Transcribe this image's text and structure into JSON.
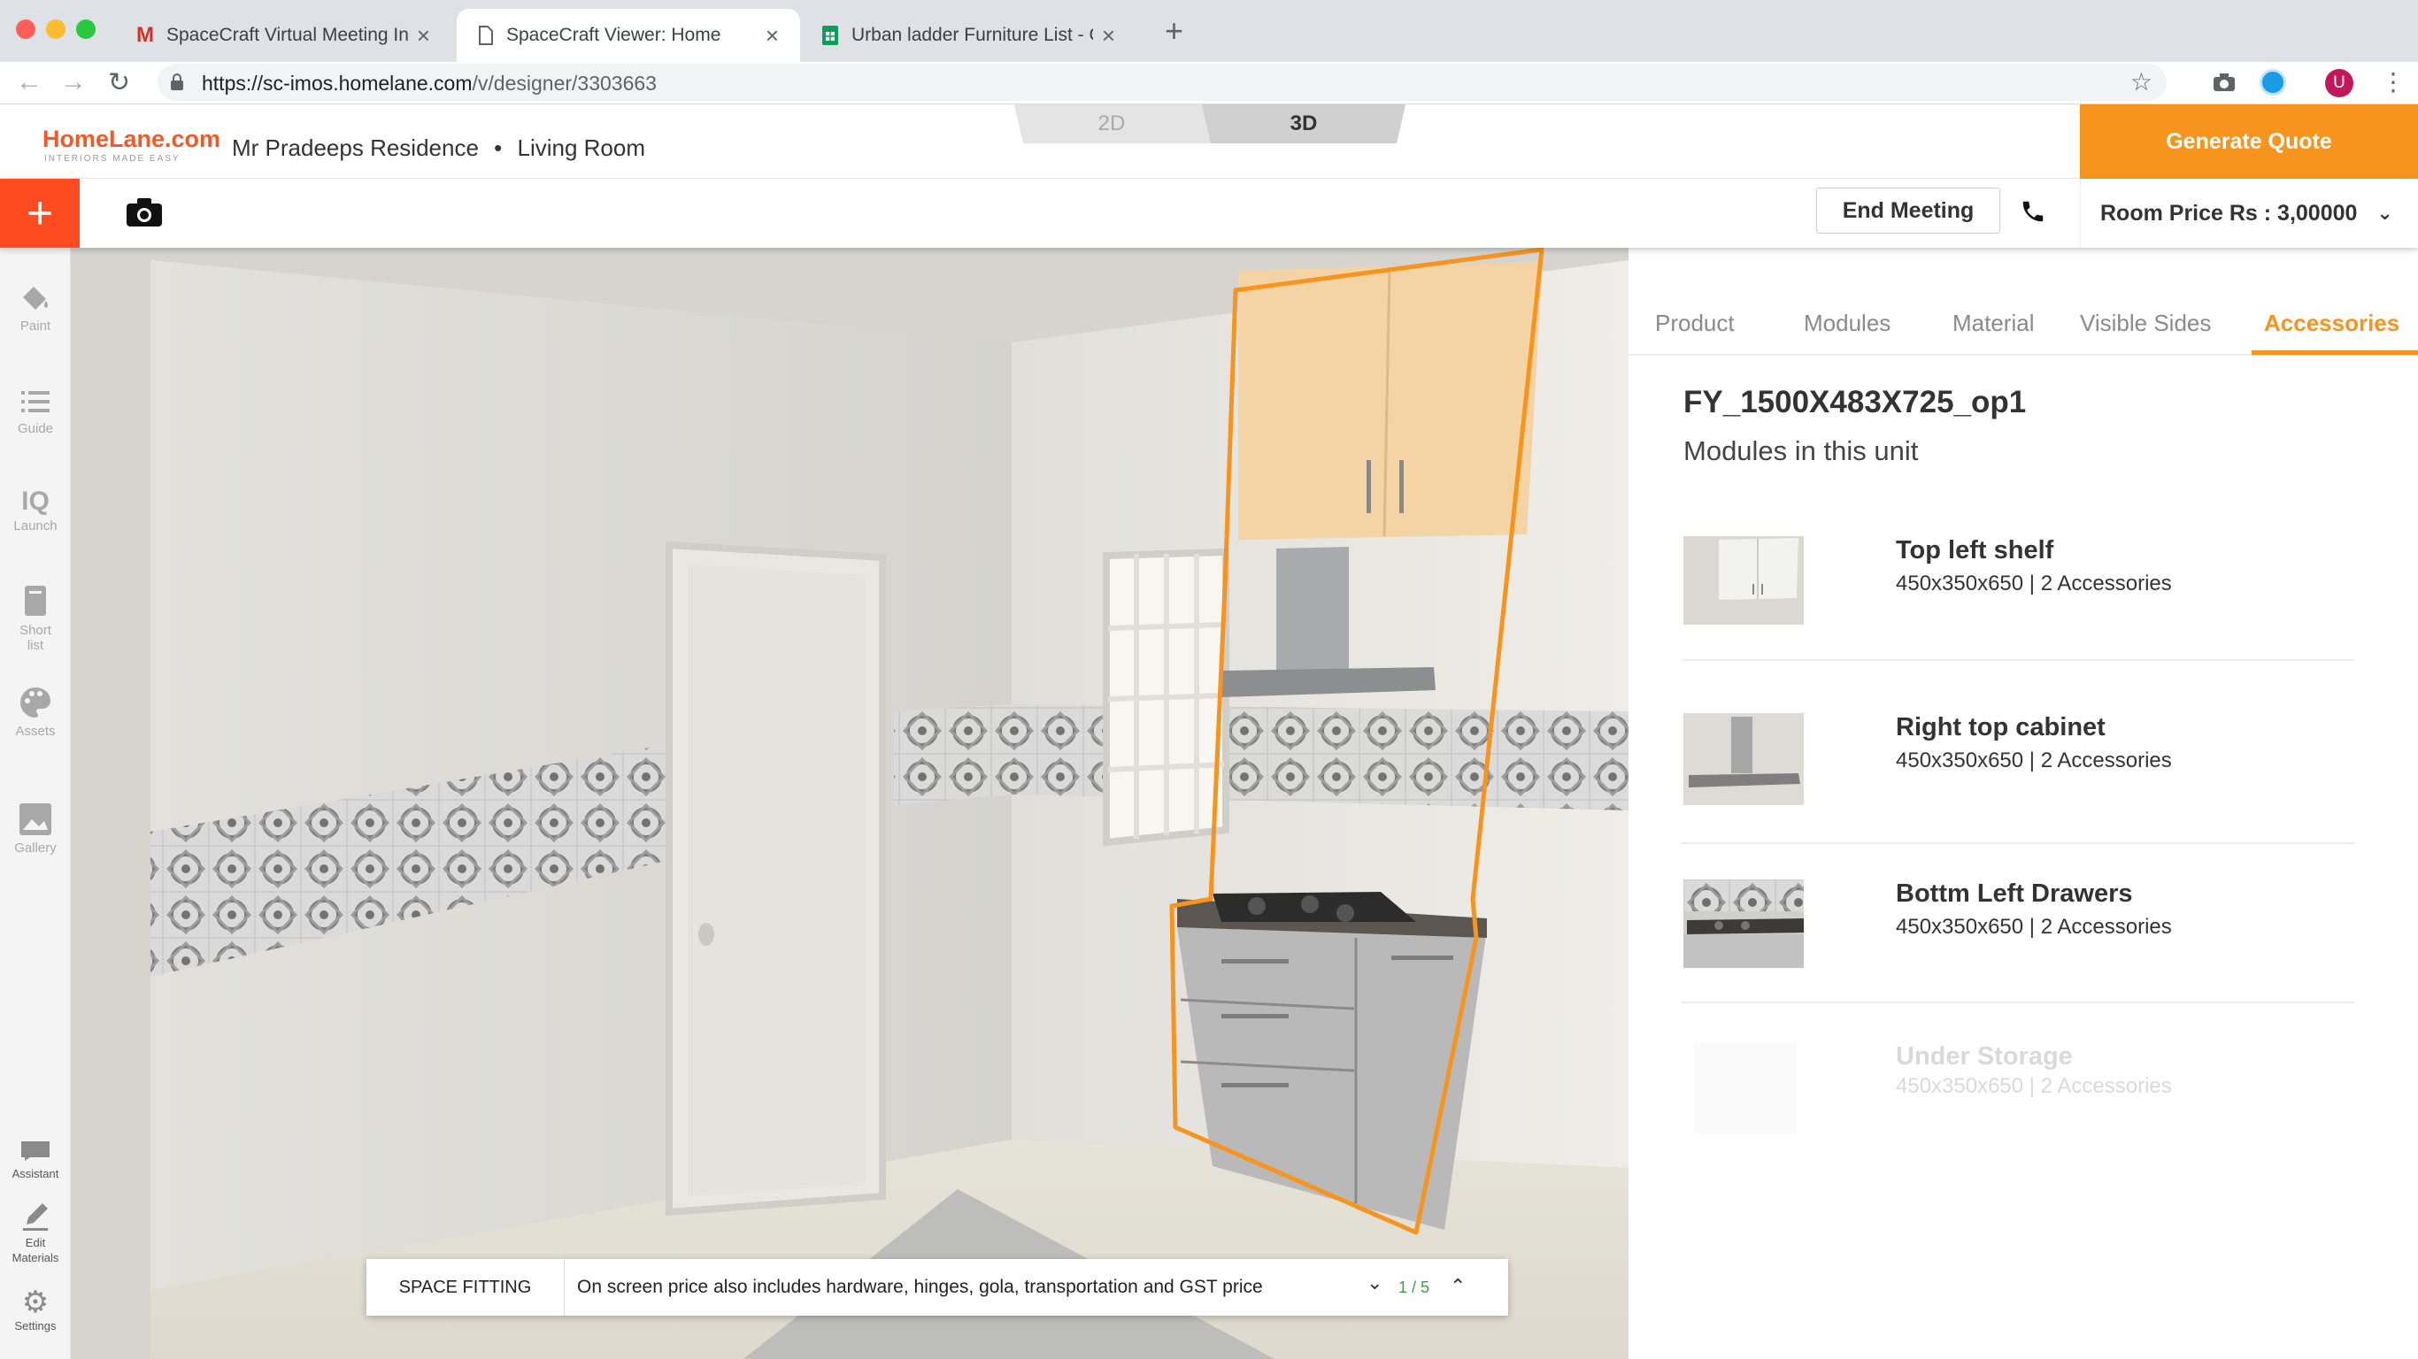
{
  "browser": {
    "tabs": [
      {
        "title": "SpaceCraft Virtual Meeting Inv",
        "icon": "gmail-icon"
      },
      {
        "title": "SpaceCraft Viewer: Home",
        "icon": "page-icon"
      },
      {
        "title": "Urban ladder Furniture List - G",
        "icon": "sheets-icon"
      }
    ],
    "url_domain": "https://sc-imos.homelane.com",
    "url_path": "/v/designer/3303663",
    "profile_initial": "U"
  },
  "app": {
    "logo": "HomeLane.com",
    "logo_tagline": "INTERIORS MADE EASY",
    "project_name": "Mr Pradeeps Residence",
    "room_name": "Living Room",
    "view_2d": "2D",
    "view_3d": "3D",
    "generate_quote": "Generate Quote",
    "end_meeting": "End Meeting",
    "room_price": "Room Price Rs : 3,00000",
    "accent_color": "#f7941d",
    "add_color": "#ff4b1f"
  },
  "rail": {
    "paint": "Paint",
    "guide": "Guide",
    "launch": "Launch",
    "shortlist_1": "Short",
    "shortlist_2": "list",
    "assets": "Assets",
    "gallery": "Gallery",
    "assistant": "Assistant",
    "edit_materials_1": "Edit",
    "edit_materials_2": "Materials",
    "settings": "Settings"
  },
  "notice": {
    "label": "SPACE FITTING",
    "text": "On screen price also includes hardware, hinges, gola, transportation and GST price",
    "page": "1 / 5"
  },
  "panel": {
    "tabs": [
      "Product",
      "Modules",
      "Material",
      "Visible Sides",
      "Accessories"
    ],
    "active_tab": "Accessories",
    "unit_name": "FY_1500X483X725_op1",
    "modules_title": "Modules in this unit",
    "modules": [
      {
        "name": "Top left shelf",
        "dims": "450x350x650 | 2 Accessories"
      },
      {
        "name": "Right top cabinet",
        "dims": "450x350x650 | 2 Accessories"
      },
      {
        "name": "Bottm Left Drawers",
        "dims": "450x350x650 | 2 Accessories"
      },
      {
        "name": "Under Storage",
        "dims": "450x350x650 | 2 Accessories"
      }
    ]
  }
}
